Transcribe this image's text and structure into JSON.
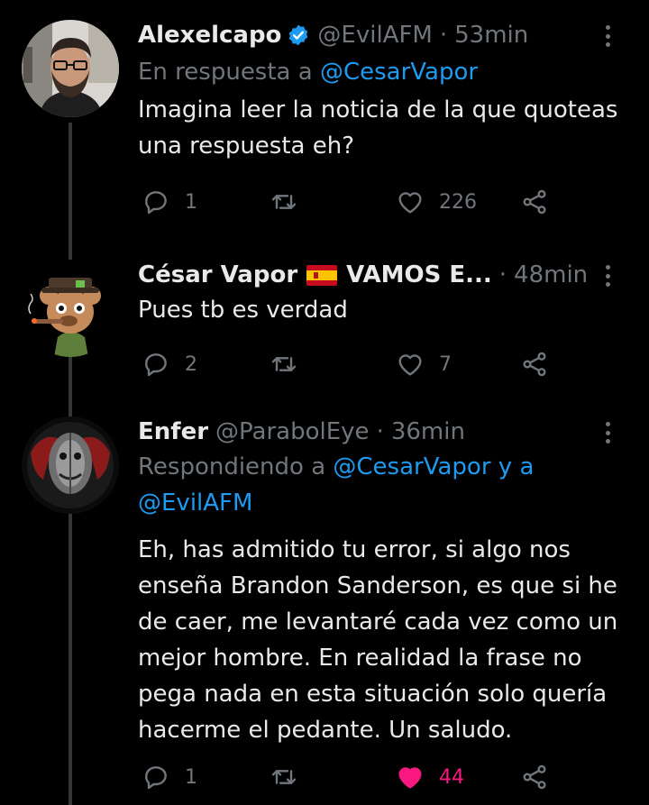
{
  "tweets": [
    {
      "name": "Alexelcapo",
      "verified": true,
      "handle": "@EvilAFM",
      "time": "53min",
      "reply_prefix": "En respuesta a ",
      "reply_mention": "@CesarVapor",
      "text": "Imagina leer la noticia de la que quoteas una respuesta eh?",
      "replies": "1",
      "retweets": "",
      "likes": "226",
      "liked": false
    },
    {
      "name": "César Vapor",
      "name_suffix": "VAMOS E...",
      "flag": "es-flag-icon",
      "time": "48min",
      "text": "Pues tb es verdad",
      "replies": "2",
      "retweets": "",
      "likes": "7",
      "liked": false
    },
    {
      "name": "Enfer",
      "handle": "@ParabolEye",
      "time": "36min",
      "reply_prefix": "Respondiendo a ",
      "reply_mention": "@CesarVapor y a @EvilAFM",
      "text": "Eh, has admitido tu error, si algo nos enseña Brandon Sanderson, es que si he de caer, me levantaré cada vez como un mejor hombre. En realidad la frase no pega nada en esta situación solo quería hacerme el pedante. Un saludo.",
      "replies": "1",
      "retweets": "",
      "likes": "44",
      "liked": true
    }
  ],
  "colors": {
    "background": "#000000",
    "text": "#e7e9ea",
    "secondary": "#71767b",
    "accent": "#1d9bf0",
    "like_active": "#f91880",
    "thread_line": "#333639"
  }
}
